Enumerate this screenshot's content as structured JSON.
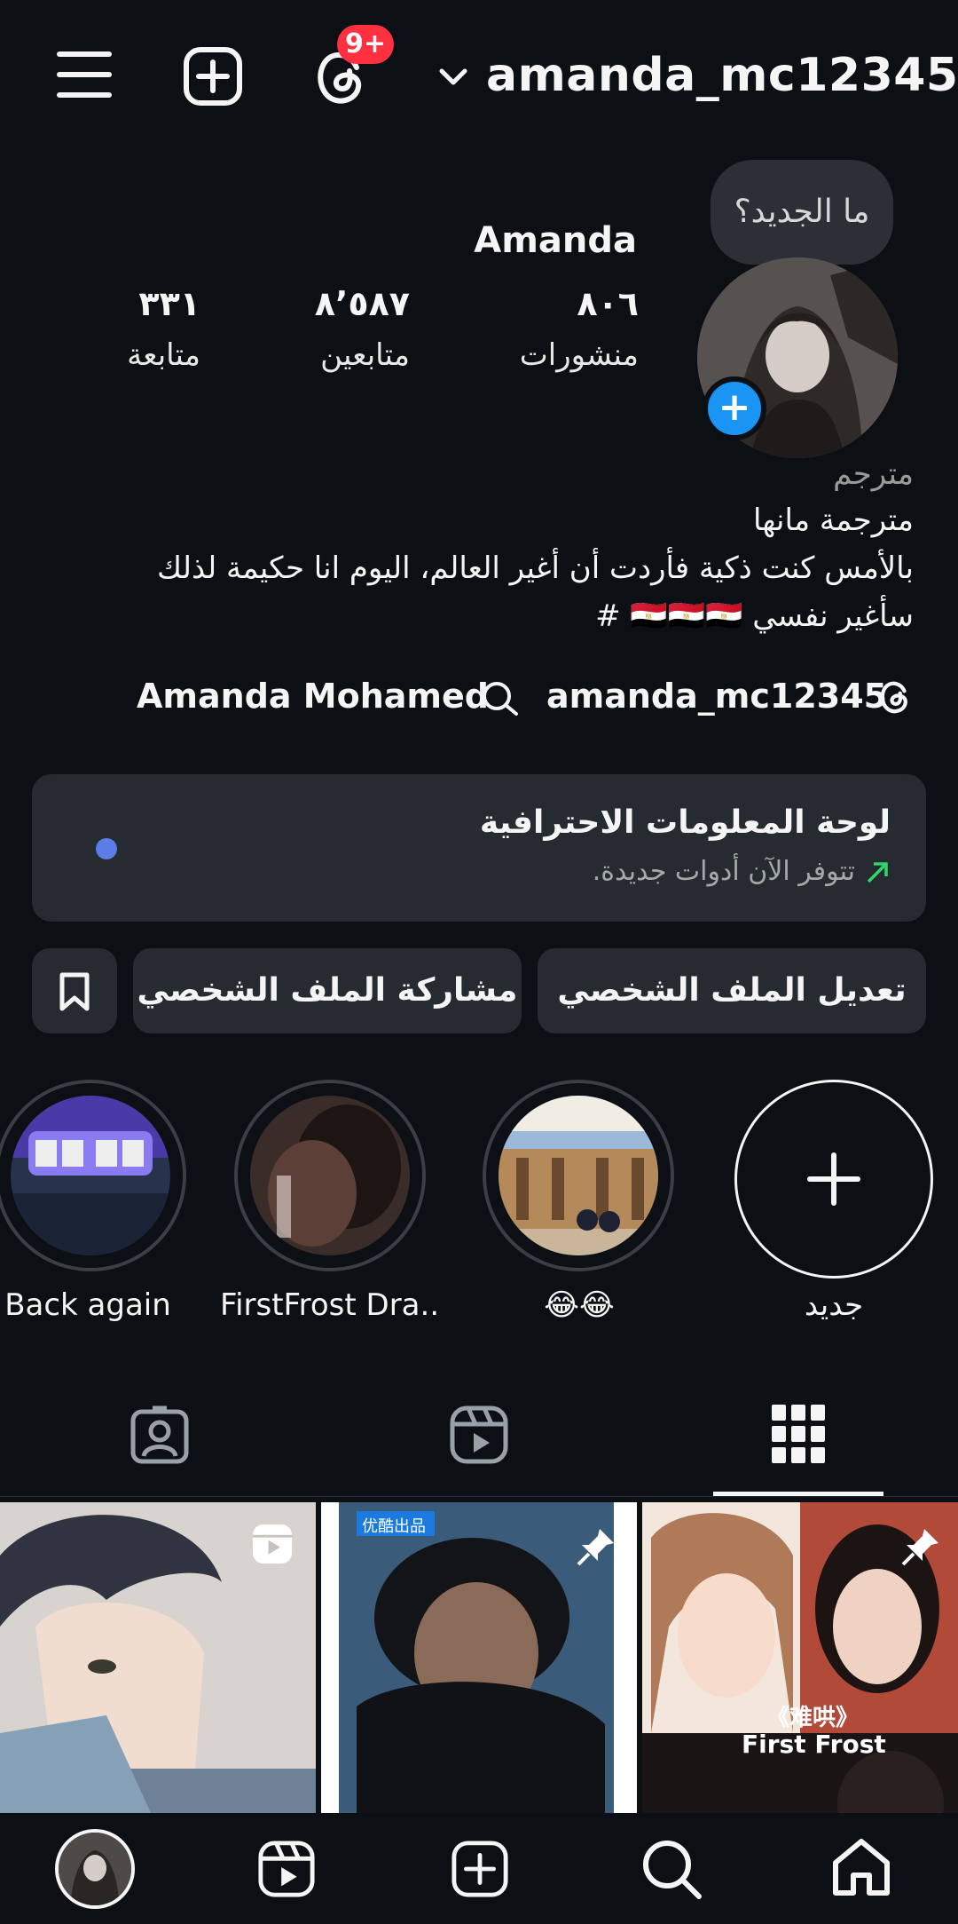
{
  "header": {
    "username": "amanda_mc12345",
    "notifications_badge": "9+",
    "icons": [
      "menu-icon",
      "create-icon",
      "threads-icon",
      "chevron-down-icon"
    ]
  },
  "note_bubble": "ما الجديد؟",
  "profile": {
    "display_name": "Amanda",
    "stats": [
      {
        "value": "٨٠٦",
        "label": "منشورات"
      },
      {
        "value": "٨٬٥٨٧",
        "label": "متابعين"
      },
      {
        "value": "٣٣١",
        "label": "متابعة"
      }
    ],
    "bio": {
      "category": "مترجم",
      "line1": "مترجمة مانها",
      "line2": "بالأمس كنت ذكية فأردت أن أغير العالم، اليوم انا حكيمة لذلك",
      "line3": "سأغير نفسي 🇪🇬🇪🇬🇪🇬 #"
    },
    "links": {
      "threads": "amanda_mc12345",
      "name": "Amanda Mohamed"
    }
  },
  "pro_dashboard": {
    "title": "لوحة المعلومات الاحترافية",
    "subtitle": "تتوفر الآن أدوات جديدة."
  },
  "buttons": {
    "edit_profile": "تعديل الملف الشخصي",
    "share_profile": "مشاركة الملف الشخصي"
  },
  "highlights": [
    {
      "label": "Back again"
    },
    {
      "label": "FirstFrost Dra..."
    },
    {
      "label": "😂😂"
    },
    {
      "label": "جديد"
    }
  ],
  "grid": [
    {
      "overlay": "reels-icon"
    },
    {
      "overlay": "pin-icon",
      "tag": "优酷出品"
    },
    {
      "overlay": "pin-icon",
      "caption_cn": "《难哄》",
      "caption": "First Frost"
    }
  ],
  "colors": {
    "background": "#0c0f14",
    "card": "#262a31",
    "badge": "#ff3040",
    "accent": "#1a95f6",
    "dot": "#5a7de8"
  }
}
